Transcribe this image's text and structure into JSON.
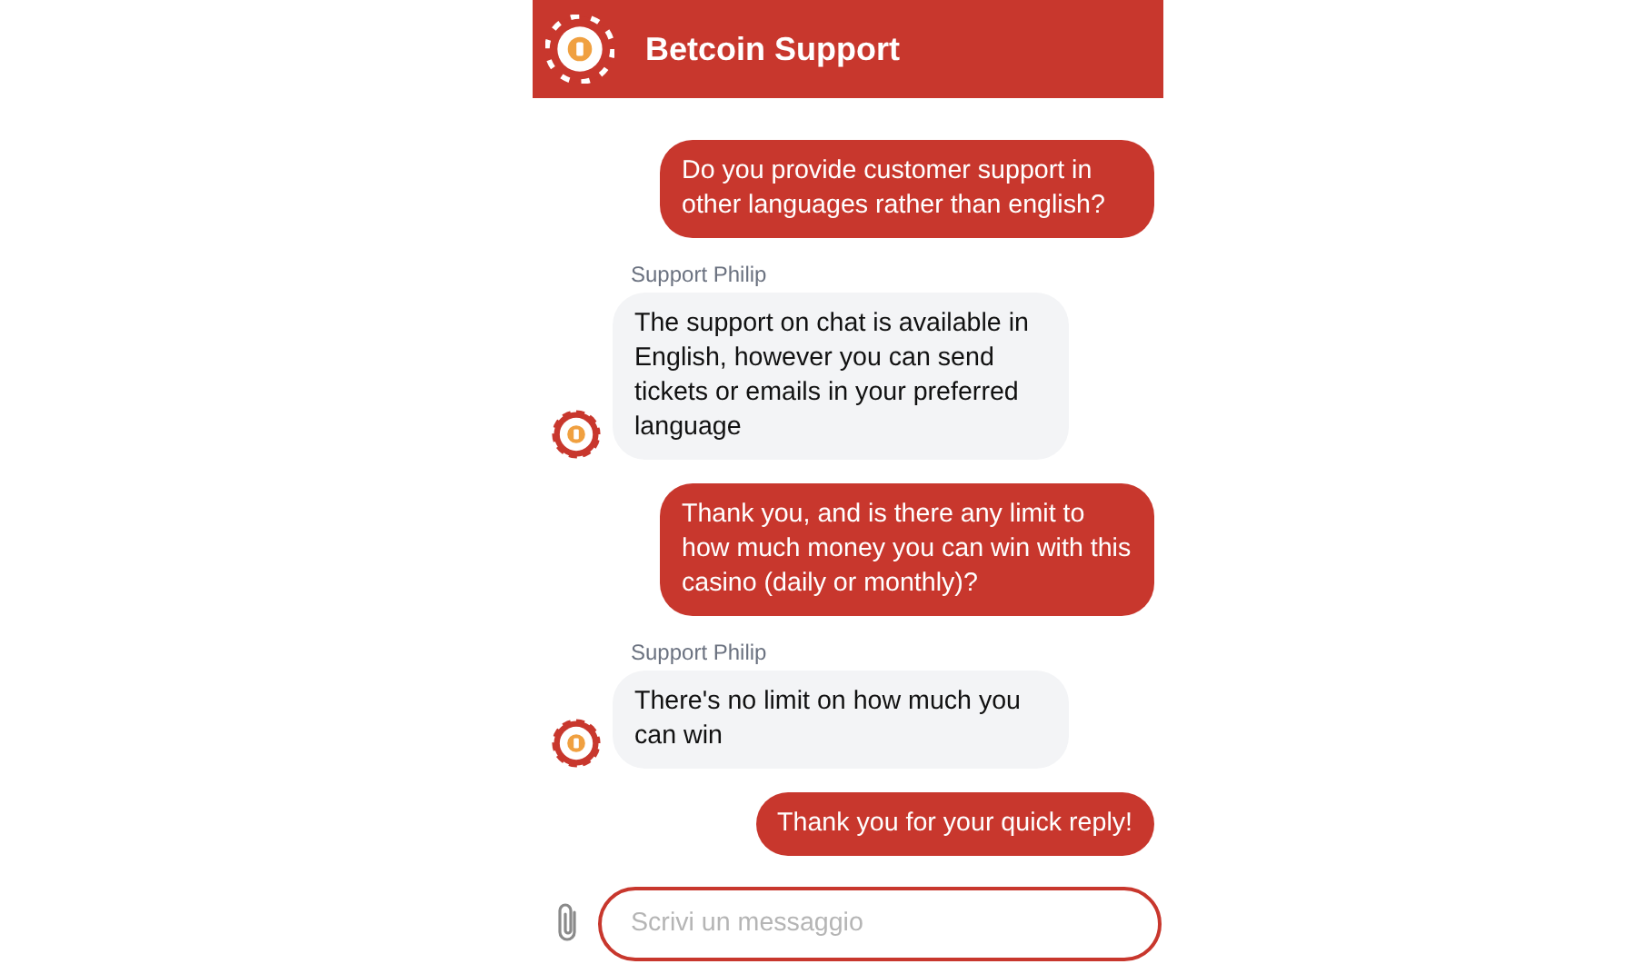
{
  "header": {
    "title": "Betcoin Support"
  },
  "messages": [
    {
      "kind": "outgoing",
      "text": "Do you provide customer support in other languages rather than english?"
    },
    {
      "kind": "incoming",
      "sender": "Support Philip",
      "text": "The support on chat is available in English, however you can send tickets or emails in your preferred language"
    },
    {
      "kind": "outgoing",
      "text": "Thank you, and is there any limit to how much money you can win with this casino (daily or monthly)?"
    },
    {
      "kind": "incoming",
      "sender": "Support Philip",
      "text": "There's no limit on how much you can win"
    },
    {
      "kind": "outgoing",
      "text": "Thank you for your quick reply!"
    }
  ],
  "composer": {
    "placeholder": "Scrivi un messaggio"
  }
}
